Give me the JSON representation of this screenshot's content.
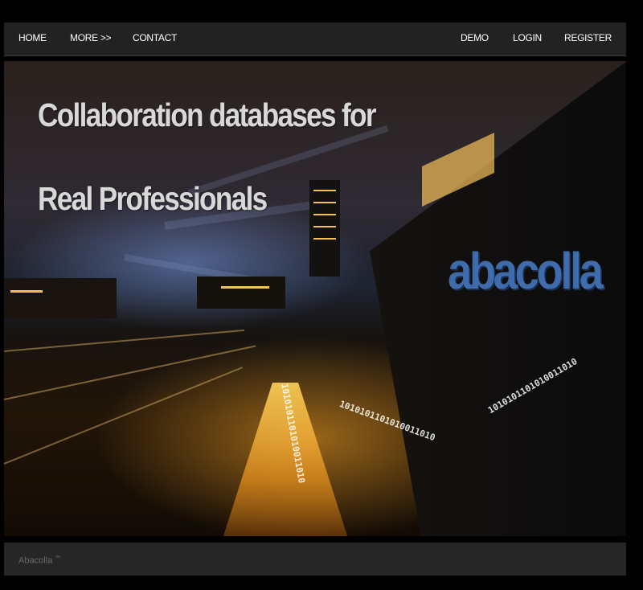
{
  "nav": {
    "left": [
      {
        "label": "HOME"
      },
      {
        "label": "MORE >>"
      },
      {
        "label": "CONTACT"
      }
    ],
    "right": [
      {
        "label": "DEMO"
      },
      {
        "label": "LOGIN"
      },
      {
        "label": "REGISTER"
      }
    ]
  },
  "hero": {
    "headline_line1": "Collaboration databases for",
    "headline_line2": "Real Professionals",
    "logo_text": "abacolla",
    "binary_text": "1010101101010011010"
  },
  "footer": {
    "brand": "Abacolla",
    "trademark": "™"
  },
  "colors": {
    "navbar_bg": "#222222",
    "footer_bg": "#262626",
    "headline": "#d8d8d8",
    "logo": "#4678be"
  }
}
